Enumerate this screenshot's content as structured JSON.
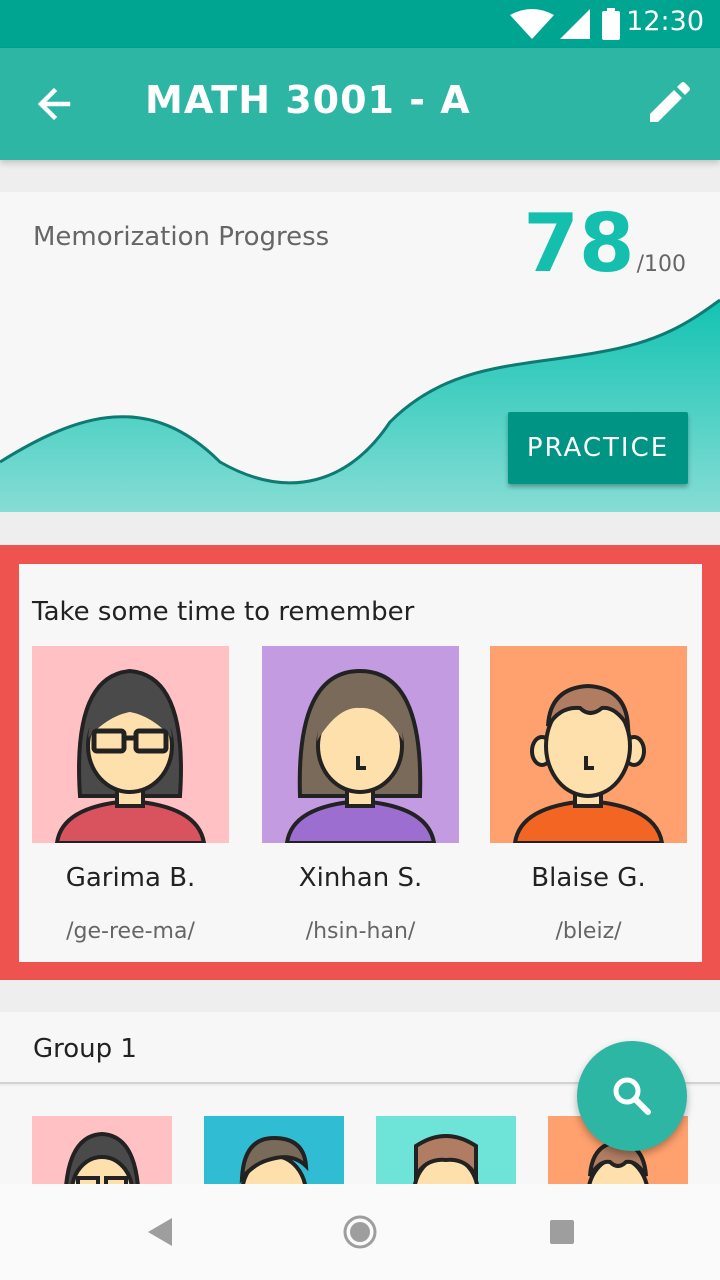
{
  "status_bar": {
    "time": "12:30"
  },
  "app_bar": {
    "title": "MATH 3001 - A"
  },
  "progress": {
    "label": "Memorization Progress",
    "value": "78",
    "max": "/100",
    "practice_label": "PRACTICE"
  },
  "remember": {
    "title": "Take some time to remember",
    "people": [
      {
        "name": "Garima B.",
        "phonetic": "/ge-ree-ma/",
        "bg": "#ffc1c3"
      },
      {
        "name": "Xinhan S.",
        "phonetic": "/hsin-han/",
        "bg": "#c39be0"
      },
      {
        "name": "Blaise G.",
        "phonetic": "/bleiz/",
        "bg": "#ffa16e"
      }
    ]
  },
  "group": {
    "title": "Group 1"
  },
  "colors": {
    "accent": "#2db6a4",
    "status": "#00a592",
    "highlight": "#ef5350",
    "teal_text": "#14bfae"
  },
  "icons": [
    "wifi-icon",
    "signal-icon",
    "battery-icon",
    "back-arrow-icon",
    "pencil-icon",
    "search-icon",
    "nav-back-icon",
    "nav-home-icon",
    "nav-recents-icon"
  ]
}
